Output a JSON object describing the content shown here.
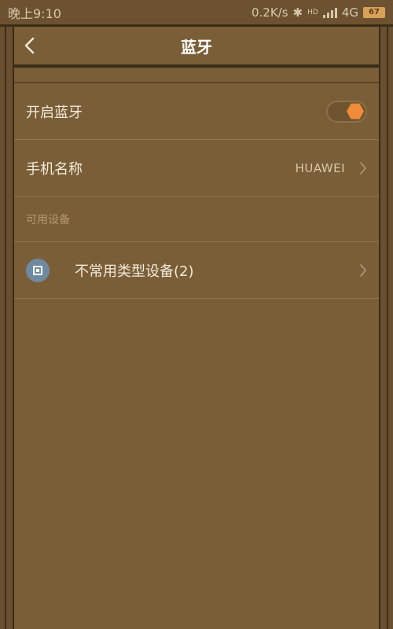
{
  "status_bar": {
    "time": "晚上9:10",
    "network_speed": "0.2K/s",
    "bluetooth_icon": "bluetooth-icon",
    "hd_label": "HD",
    "network_type": "4G",
    "battery_level": "67"
  },
  "header": {
    "back_icon": "chevron-left-icon",
    "title": "蓝牙"
  },
  "settings": {
    "bluetooth_toggle_label": "开启蓝牙",
    "bluetooth_enabled": true,
    "phone_name_label": "手机名称",
    "phone_name_value": "HUAWEI"
  },
  "available_devices": {
    "section_label": "可用设备",
    "items": [
      {
        "label": "不常用类型设备(2)",
        "icon": "device-icon"
      }
    ]
  },
  "colors": {
    "background": "#7a5e37",
    "accent": "#f08b3a"
  }
}
